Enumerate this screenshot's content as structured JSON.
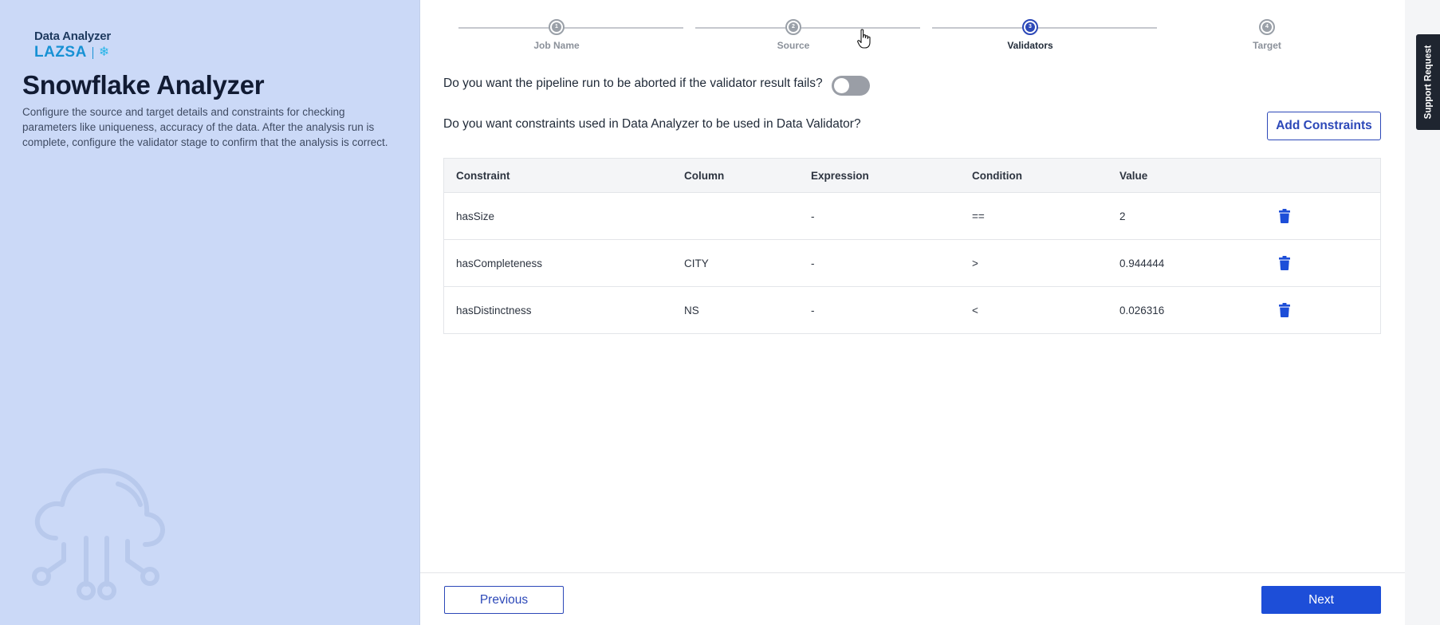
{
  "brand": {
    "product": "Data Analyzer",
    "name": "LAZSA",
    "partner_icon": "snowflake-icon"
  },
  "left": {
    "title": "Snowflake Analyzer",
    "description": "Configure the source and target details and constraints for checking parameters like uniqueness, accuracy of the data. After the analysis run is complete, configure the validator stage to confirm that the analysis is correct."
  },
  "stepper": {
    "active_index": 2,
    "steps": [
      {
        "number": "1",
        "label": "Job Name"
      },
      {
        "number": "2",
        "label": "Source"
      },
      {
        "number": "3",
        "label": "Validators"
      },
      {
        "number": "4",
        "label": "Target"
      }
    ]
  },
  "validator": {
    "abort_question": "Do you want the pipeline run to be aborted if the validator result fails?",
    "abort_toggle_on": false,
    "constraints_question": "Do you want constraints used in Data Analyzer to be used in Data Validator?",
    "add_constraints_label": "Add Constraints"
  },
  "table": {
    "headers": {
      "constraint": "Constraint",
      "column": "Column",
      "expression": "Expression",
      "condition": "Condition",
      "value": "Value"
    },
    "rows": [
      {
        "constraint": "hasSize",
        "column": "",
        "expression": "-",
        "condition": "==",
        "value": "2",
        "action_icon": "trash-icon"
      },
      {
        "constraint": "hasCompleteness",
        "column": "CITY",
        "expression": "-",
        "condition": ">",
        "value": "0.944444",
        "action_icon": "trash-icon"
      },
      {
        "constraint": "hasDistinctness",
        "column": "NS",
        "expression": "-",
        "condition": "<",
        "value": "0.026316",
        "action_icon": "trash-icon"
      }
    ]
  },
  "footer": {
    "previous_label": "Previous",
    "next_label": "Next"
  },
  "support": {
    "label": "Support Request"
  },
  "colors": {
    "accent": "#1d4ed8",
    "left_panel_bg": "#cbd9f7",
    "delete_icon": "#1d4ed8"
  }
}
